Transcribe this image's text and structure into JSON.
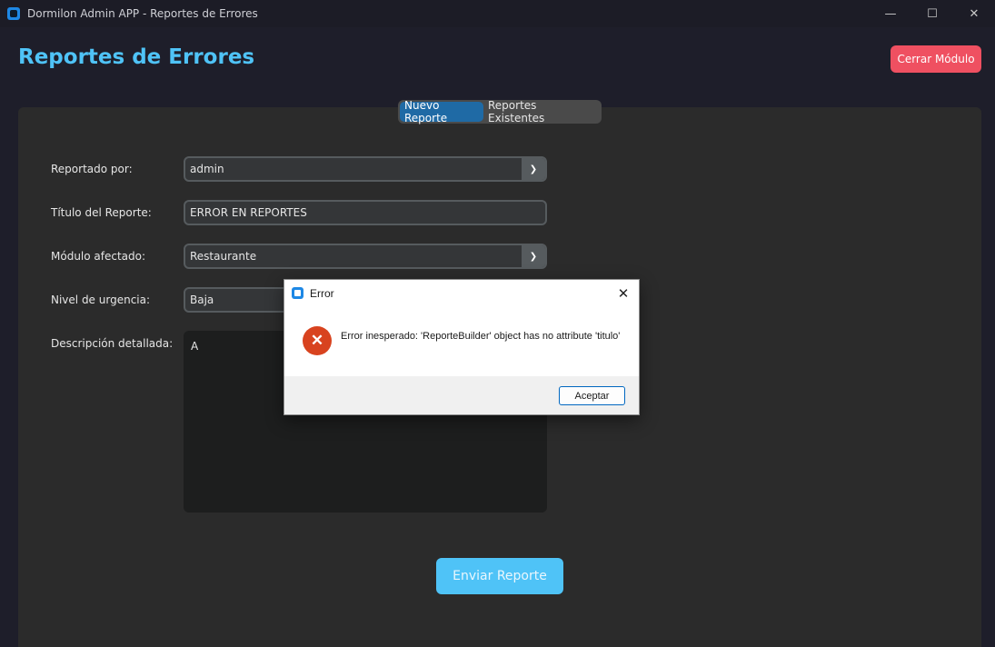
{
  "window": {
    "title": "Dormilon Admin APP - Reportes de Errores",
    "controls": {
      "minimize": "—",
      "maximize": "☐",
      "close": "✕"
    }
  },
  "header": {
    "title": "Reportes de Errores",
    "close_module_label": "Cerrar Módulo"
  },
  "tabs": [
    {
      "label": "Nuevo Reporte",
      "active": true
    },
    {
      "label": "Reportes Existentes",
      "active": false
    }
  ],
  "form": {
    "reported_by": {
      "label": "Reportado por:",
      "value": "admin"
    },
    "title": {
      "label": "Título del Reporte:",
      "value": "ERROR EN REPORTES"
    },
    "module": {
      "label": "Módulo afectado:",
      "value": "Restaurante"
    },
    "urgency": {
      "label": "Nivel de urgencia:",
      "value": "Baja"
    },
    "description": {
      "label": "Descripción detallada:",
      "value": "A"
    },
    "submit_label": "Enviar Reporte"
  },
  "dialog": {
    "title": "Error",
    "message": "Error inesperado: 'ReporteBuilder' object has no attribute 'titulo'",
    "accept_label": "Aceptar",
    "close_glyph": "✕",
    "error_glyph": "✕"
  },
  "colors": {
    "accent": "#4fc3f7",
    "danger": "#ef5061",
    "tab_active": "#1f6aa5",
    "error_icon": "#d8431f"
  }
}
